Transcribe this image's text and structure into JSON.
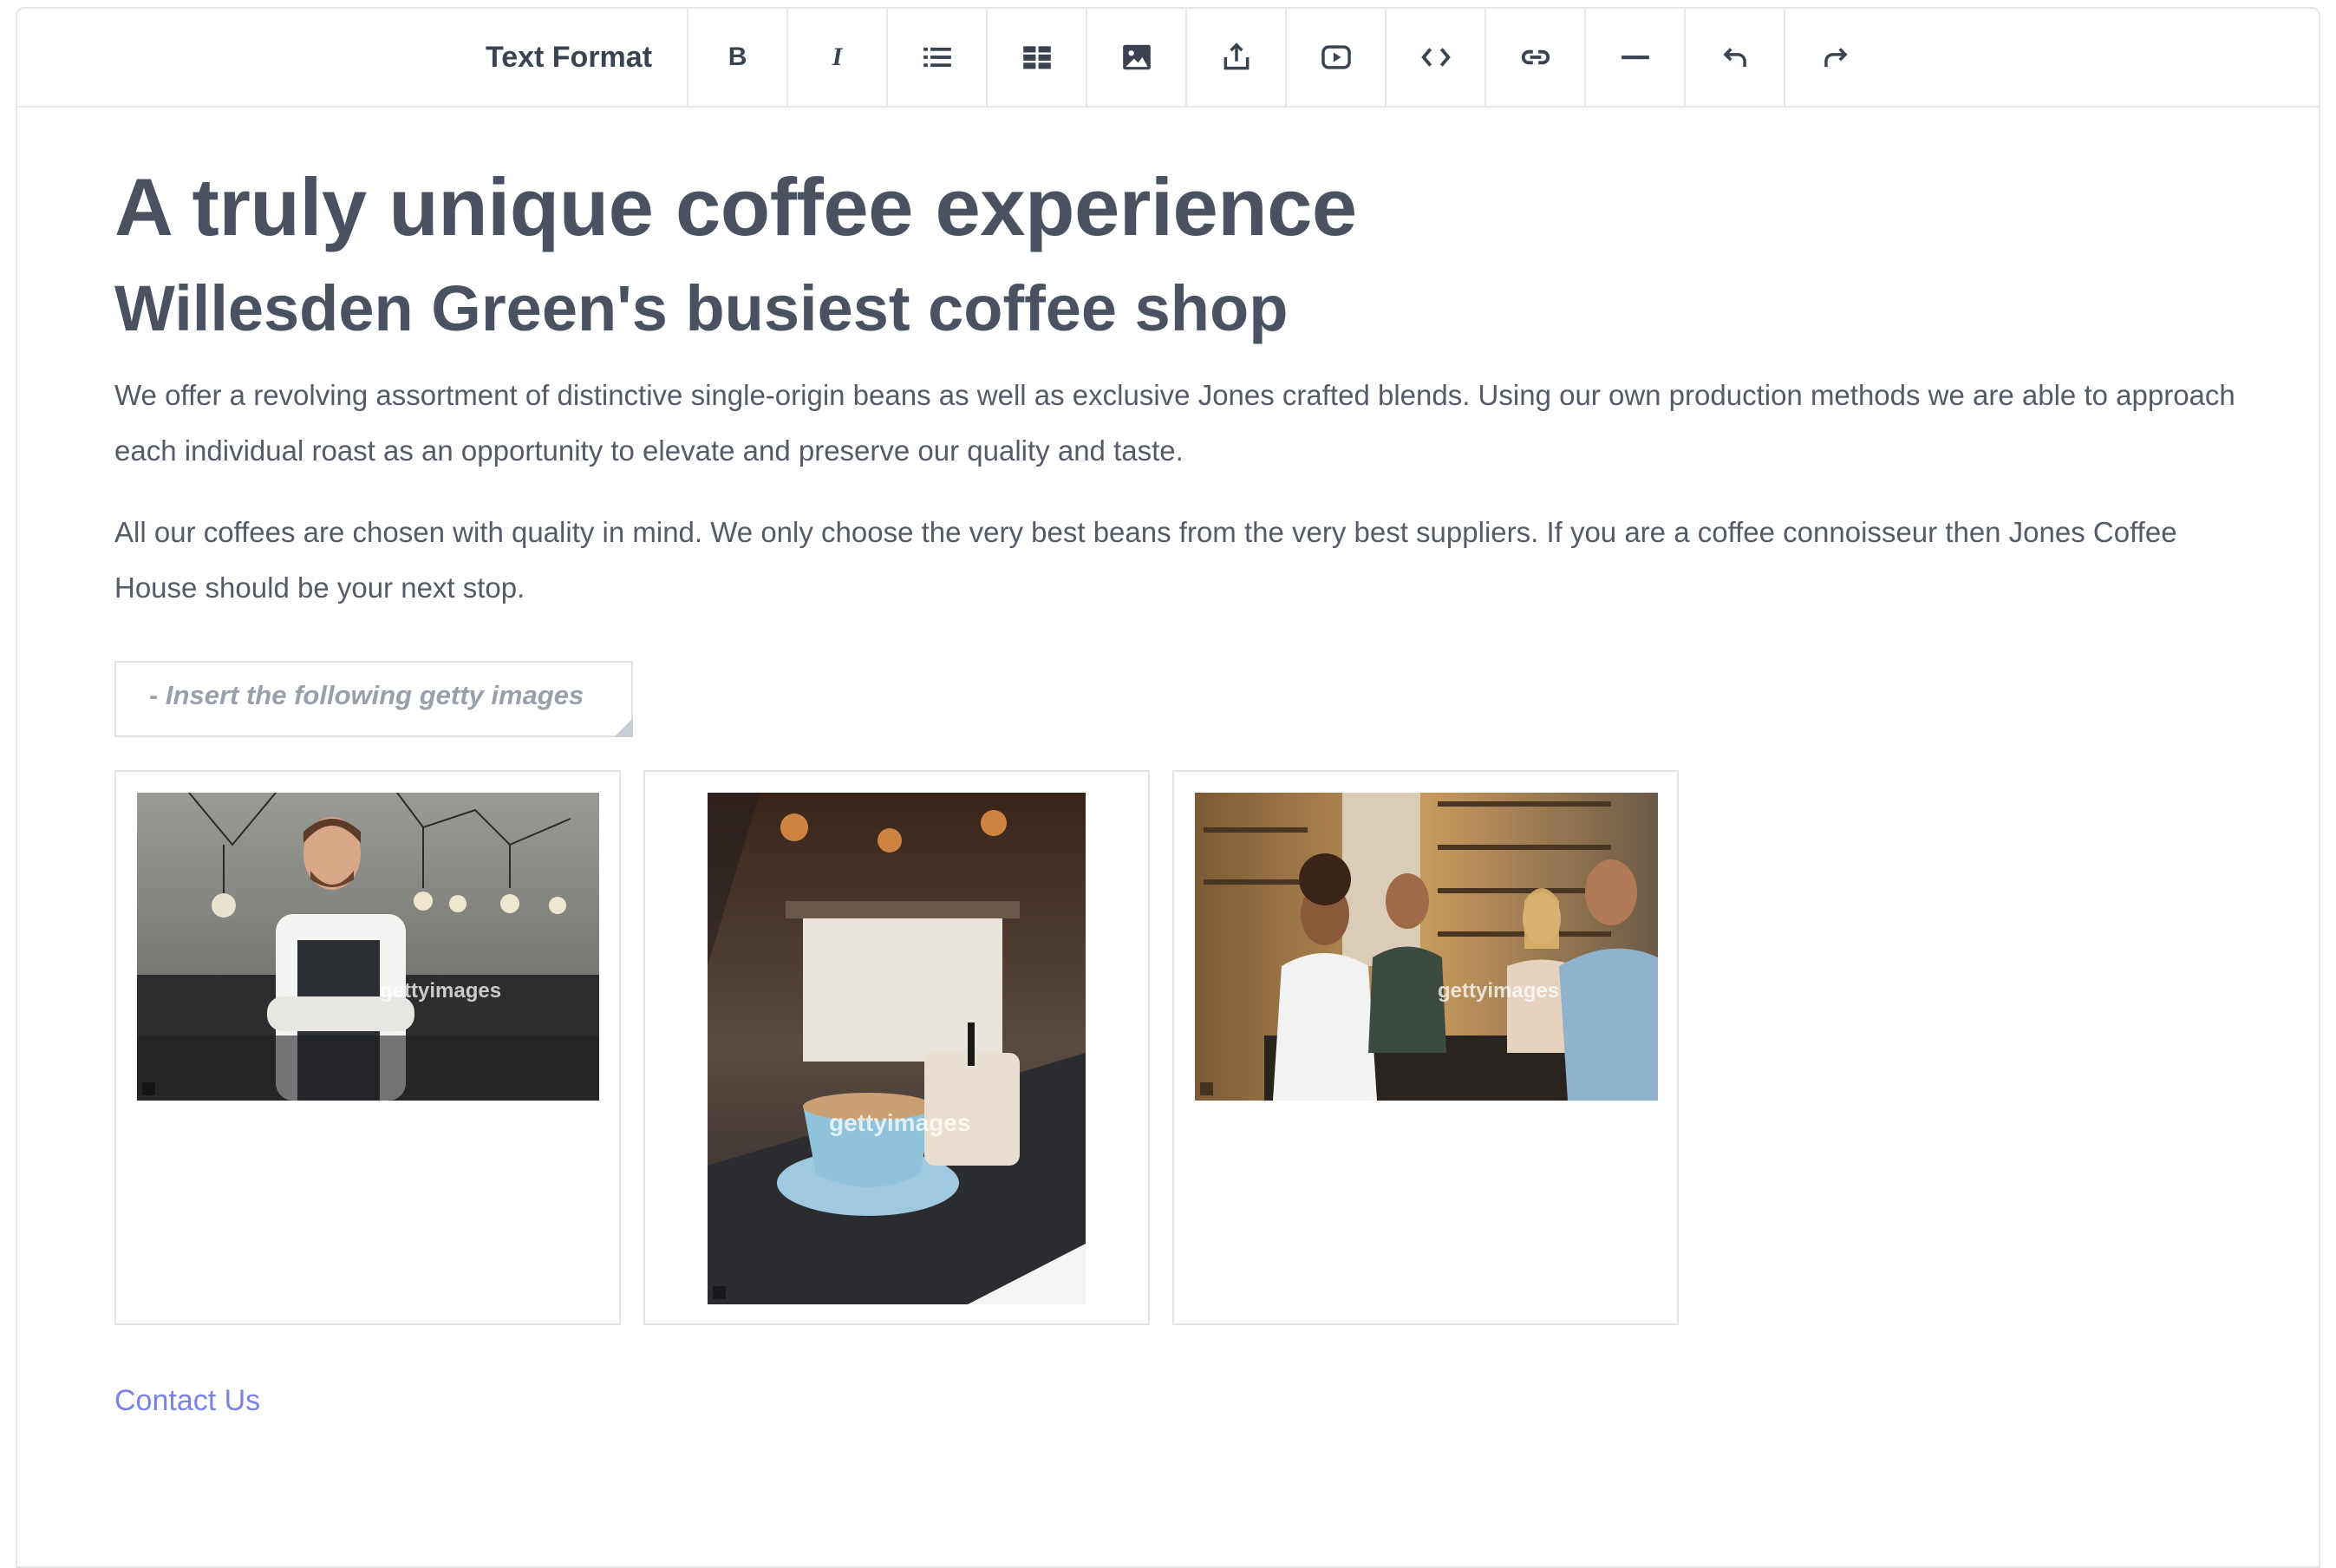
{
  "toolbar": {
    "format_label": "Text Format",
    "buttons": [
      {
        "name": "bold-button",
        "glyph": "B"
      },
      {
        "name": "italic-button",
        "glyph": "I"
      },
      {
        "name": "list-button",
        "icon": "list-icon"
      },
      {
        "name": "table-button",
        "icon": "table-icon"
      },
      {
        "name": "image-button",
        "icon": "image-icon"
      },
      {
        "name": "upload-button",
        "icon": "upload-icon"
      },
      {
        "name": "video-button",
        "icon": "video-icon"
      },
      {
        "name": "code-button",
        "icon": "code-icon"
      },
      {
        "name": "link-button",
        "icon": "link-icon"
      },
      {
        "name": "horizontal-rule-button",
        "icon": "horizontal-rule-icon"
      },
      {
        "name": "undo-button",
        "icon": "undo-icon"
      },
      {
        "name": "redo-button",
        "icon": "redo-icon"
      }
    ]
  },
  "content": {
    "heading": "A truly unique coffee experience",
    "subheading": "Willesden Green's busiest coffee shop",
    "paragraphs": [
      "We offer a revolving assortment of distinctive single-origin beans as well as exclusive Jones crafted blends. Using our own production methods we are able to approach each individual roast as an opportunity to elevate and preserve our quality and taste.",
      "All our coffees are chosen with quality in mind. We only choose the very best beans from the very best suppliers. If you are a coffee connoisseur then Jones Coffee House should be your next stop."
    ],
    "note": "- Insert the following getty images",
    "images": [
      {
        "watermark": "gettyimages",
        "alt": "barista-photo"
      },
      {
        "watermark": "gettyimages",
        "alt": "coffee-cup-photo"
      },
      {
        "watermark": "gettyimages",
        "alt": "friends-cafe-photo"
      }
    ],
    "contact_link": "Contact Us"
  },
  "colors": {
    "heading": "#4a5160",
    "body_text": "#555b66",
    "link": "#7b82e6",
    "border": "#e0e3e8"
  }
}
